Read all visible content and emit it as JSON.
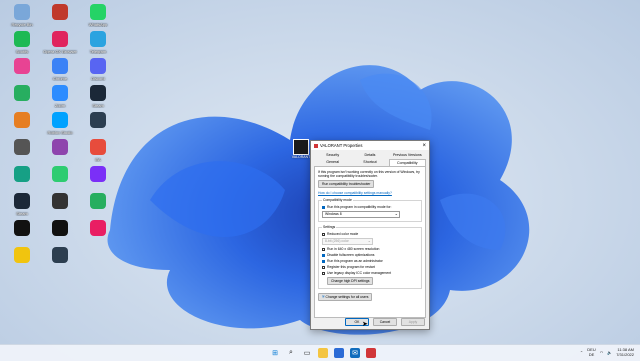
{
  "desktop": {
    "icons": [
      {
        "label": "Recycle Bin",
        "icon": "recycle-bin-icon",
        "color": "#7aa7d9"
      },
      {
        "label": "",
        "icon": "app-icon",
        "color": "#c0392b"
      },
      {
        "label": "WhatsApp",
        "icon": "whatsapp-icon",
        "color": "#25d366"
      },
      {
        "label": "Spotify",
        "icon": "spotify-icon",
        "color": "#1db954"
      },
      {
        "label": "Opera GX Browser",
        "icon": "opera-gx-icon",
        "color": "#e0245e"
      },
      {
        "label": "Telegram",
        "icon": "telegram-icon",
        "color": "#2aa3e0"
      },
      {
        "label": "",
        "icon": "app-icon",
        "color": "#e84393"
      },
      {
        "label": "Chrome",
        "icon": "chrome-icon",
        "color": "#3b82f6"
      },
      {
        "label": "Discord",
        "icon": "discord-icon",
        "color": "#5865f2"
      },
      {
        "label": "",
        "icon": "app-icon",
        "color": "#27ae60"
      },
      {
        "label": "Zoom",
        "icon": "zoom-icon",
        "color": "#2d8cff"
      },
      {
        "label": "Steam",
        "icon": "steam-icon",
        "color": "#1b2838"
      },
      {
        "label": "",
        "icon": "app-icon",
        "color": "#e67e22"
      },
      {
        "label": "Roblox Studio",
        "icon": "roblox-studio-icon",
        "color": "#00a2ff"
      },
      {
        "label": "",
        "icon": "app-icon",
        "color": "#2c3e50"
      },
      {
        "label": "",
        "icon": "app-icon",
        "color": "#555"
      },
      {
        "label": "",
        "icon": "app-icon",
        "color": "#8e44ad"
      },
      {
        "label": "EA",
        "icon": "ea-icon",
        "color": "#e74c3c"
      },
      {
        "label": "",
        "icon": "app-icon",
        "color": "#16a085"
      },
      {
        "label": "",
        "icon": "app-icon",
        "color": "#2ecc71"
      },
      {
        "label": "",
        "icon": "app-icon",
        "color": "#7b2ff7"
      },
      {
        "label": "Steam",
        "icon": "steam-icon",
        "color": "#1b2838"
      },
      {
        "label": "",
        "icon": "app-icon",
        "color": "#333"
      },
      {
        "label": "",
        "icon": "app-icon",
        "color": "#27ae60"
      },
      {
        "label": "",
        "icon": "app-icon",
        "color": "#111"
      },
      {
        "label": "",
        "icon": "app-icon",
        "color": "#111"
      },
      {
        "label": "",
        "icon": "app-icon",
        "color": "#e91e63"
      },
      {
        "label": "",
        "icon": "app-icon",
        "color": "#f1c40f"
      },
      {
        "label": "",
        "icon": "app-icon",
        "color": "#2c3e50"
      }
    ],
    "shortcut": {
      "label": "VALORANT",
      "icon": "valorant-icon"
    }
  },
  "dialog": {
    "title": "VALORANT Properties",
    "tabs": [
      "Security",
      "Details",
      "Previous Versions",
      "General",
      "Shortcut",
      "Compatibility"
    ],
    "intro": "If this program isn't working correctly on this version of Windows, try running the compatibility troubleshooter.",
    "troubleshooter_button": "Run compatibility troubleshooter",
    "manual_link": "How do I choose compatibility settings manually?",
    "compat_mode": {
      "legend": "Compatibility mode",
      "checkbox": "Run this program in compatibility mode for:",
      "select_value": "Windows 8"
    },
    "settings": {
      "legend": "Settings",
      "reduced_color": "Reduced color mode",
      "color_select": "8-bit (256) color",
      "resolution": "Run in 640 x 480 screen resolution",
      "fullscreen": "Disable fullscreen optimizations",
      "admin": "Run this program as an administrator",
      "restart": "Register this program for restart",
      "icc": "Use legacy display ICC color management",
      "dpi_button": "Change high DPI settings"
    },
    "all_users_button": "Change settings for all users",
    "ok": "OK",
    "cancel": "Cancel",
    "apply": "Apply"
  },
  "taskbar": {
    "icons": [
      "windows-start-icon",
      "search-icon",
      "task-view-icon",
      "file-explorer-icon",
      "store-icon",
      "mail-icon",
      "valorant-icon"
    ],
    "lang_top": "DEU",
    "lang_bottom": "DE",
    "time": "11:38 AM",
    "date": "7/31/2022"
  }
}
